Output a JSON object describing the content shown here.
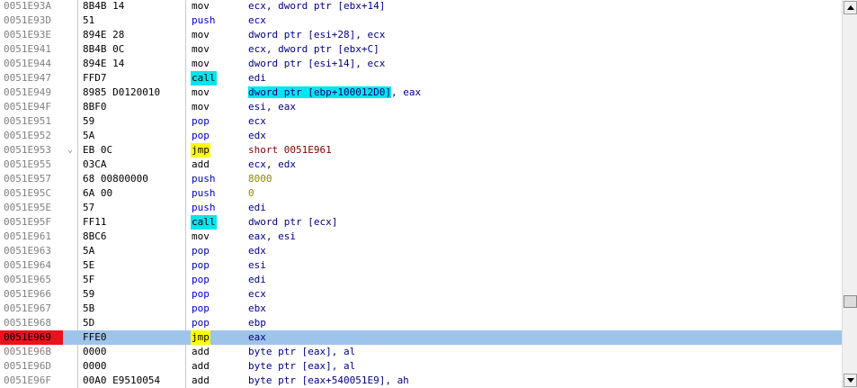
{
  "colors": {
    "selection": "#9fc4ea",
    "current_address": "#e8141b",
    "call_highlight": "#00e5ee",
    "jump_highlight": "#ffff00",
    "address_text": "#808080",
    "operand_text": "#000080",
    "stack_mnemonic": "#0000c8",
    "immediate": "#8a8a00",
    "jump_target": "#800000"
  },
  "icons": {
    "scroll_up": "triangle-up-icon",
    "scroll_down": "triangle-down-icon"
  },
  "scrollbar": {
    "position": 0.81
  },
  "rows": [
    {
      "address": "0051E93A",
      "arrow": "",
      "hex": "8B4B 14",
      "mnemonic": "mov",
      "operands": "ecx, dword ptr [ebx+14]",
      "mnemonic_style": "normal",
      "operand_style": "normal",
      "operand_hl": "",
      "operand_rest": ""
    },
    {
      "address": "0051E93D",
      "arrow": "",
      "hex": "51",
      "mnemonic": "push",
      "operands": "ecx",
      "mnemonic_style": "stack",
      "operand_style": "normal",
      "operand_hl": "",
      "operand_rest": ""
    },
    {
      "address": "0051E93E",
      "arrow": "",
      "hex": "894E 28",
      "mnemonic": "mov",
      "operands": "dword ptr [esi+28], ecx",
      "mnemonic_style": "normal",
      "operand_style": "normal",
      "operand_hl": "",
      "operand_rest": ""
    },
    {
      "address": "0051E941",
      "arrow": "",
      "hex": "8B4B 0C",
      "mnemonic": "mov",
      "operands": "ecx, dword ptr [ebx+C]",
      "mnemonic_style": "normal",
      "operand_style": "normal",
      "operand_hl": "",
      "operand_rest": ""
    },
    {
      "address": "0051E944",
      "arrow": "",
      "hex": "894E 14",
      "mnemonic": "mov",
      "operands": "dword ptr [esi+14], ecx",
      "mnemonic_style": "normal",
      "operand_style": "normal",
      "operand_hl": "",
      "operand_rest": ""
    },
    {
      "address": "0051E947",
      "arrow": "",
      "hex": "FFD7",
      "mnemonic": "call",
      "operands": "edi",
      "mnemonic_style": "call",
      "operand_style": "normal",
      "operand_hl": "",
      "operand_rest": ""
    },
    {
      "address": "0051E949",
      "arrow": "",
      "hex": "8985 D0120010",
      "mnemonic": "mov",
      "operands": "",
      "mnemonic_style": "normal",
      "operand_style": "normal",
      "operand_hl": "dword ptr [ebp+100012D0]",
      "operand_rest": ", eax"
    },
    {
      "address": "0051E94F",
      "arrow": "",
      "hex": "8BF0",
      "mnemonic": "mov",
      "operands": "esi, eax",
      "mnemonic_style": "normal",
      "operand_style": "normal",
      "operand_hl": "",
      "operand_rest": ""
    },
    {
      "address": "0051E951",
      "arrow": "",
      "hex": "59",
      "mnemonic": "pop",
      "operands": "ecx",
      "mnemonic_style": "stack",
      "operand_style": "normal",
      "operand_hl": "",
      "operand_rest": ""
    },
    {
      "address": "0051E952",
      "arrow": "",
      "hex": "5A",
      "mnemonic": "pop",
      "operands": "edx",
      "mnemonic_style": "stack",
      "operand_style": "normal",
      "operand_hl": "",
      "operand_rest": ""
    },
    {
      "address": "0051E953",
      "arrow": "⌄",
      "hex": "EB 0C",
      "mnemonic": "jmp",
      "operands": "short 0051E961",
      "mnemonic_style": "jmp",
      "operand_style": "jump",
      "operand_hl": "",
      "operand_rest": ""
    },
    {
      "address": "0051E955",
      "arrow": "",
      "hex": "03CA",
      "mnemonic": "add",
      "operands": "ecx, edx",
      "mnemonic_style": "normal",
      "operand_style": "normal",
      "operand_hl": "",
      "operand_rest": ""
    },
    {
      "address": "0051E957",
      "arrow": "",
      "hex": "68 00800000",
      "mnemonic": "push",
      "operands": "8000",
      "mnemonic_style": "stack",
      "operand_style": "imm",
      "operand_hl": "",
      "operand_rest": ""
    },
    {
      "address": "0051E95C",
      "arrow": "",
      "hex": "6A 00",
      "mnemonic": "push",
      "operands": "0",
      "mnemonic_style": "stack",
      "operand_style": "imm",
      "operand_hl": "",
      "operand_rest": ""
    },
    {
      "address": "0051E95E",
      "arrow": "",
      "hex": "57",
      "mnemonic": "push",
      "operands": "edi",
      "mnemonic_style": "stack",
      "operand_style": "normal",
      "operand_hl": "",
      "operand_rest": ""
    },
    {
      "address": "0051E95F",
      "arrow": "",
      "hex": "FF11",
      "mnemonic": "call",
      "operands": "dword ptr [ecx]",
      "mnemonic_style": "call",
      "operand_style": "normal",
      "operand_hl": "",
      "operand_rest": ""
    },
    {
      "address": "0051E961",
      "arrow": "",
      "hex": "8BC6",
      "mnemonic": "mov",
      "operands": "eax, esi",
      "mnemonic_style": "normal",
      "operand_style": "normal",
      "operand_hl": "",
      "operand_rest": ""
    },
    {
      "address": "0051E963",
      "arrow": "",
      "hex": "5A",
      "mnemonic": "pop",
      "operands": "edx",
      "mnemonic_style": "stack",
      "operand_style": "normal",
      "operand_hl": "",
      "operand_rest": ""
    },
    {
      "address": "0051E964",
      "arrow": "",
      "hex": "5E",
      "mnemonic": "pop",
      "operands": "esi",
      "mnemonic_style": "stack",
      "operand_style": "normal",
      "operand_hl": "",
      "operand_rest": ""
    },
    {
      "address": "0051E965",
      "arrow": "",
      "hex": "5F",
      "mnemonic": "pop",
      "operands": "edi",
      "mnemonic_style": "stack",
      "operand_style": "normal",
      "operand_hl": "",
      "operand_rest": ""
    },
    {
      "address": "0051E966",
      "arrow": "",
      "hex": "59",
      "mnemonic": "pop",
      "operands": "ecx",
      "mnemonic_style": "stack",
      "operand_style": "normal",
      "operand_hl": "",
      "operand_rest": ""
    },
    {
      "address": "0051E967",
      "arrow": "",
      "hex": "5B",
      "mnemonic": "pop",
      "operands": "ebx",
      "mnemonic_style": "stack",
      "operand_style": "normal",
      "operand_hl": "",
      "operand_rest": ""
    },
    {
      "address": "0051E968",
      "arrow": "",
      "hex": "5D",
      "mnemonic": "pop",
      "operands": "ebp",
      "mnemonic_style": "stack",
      "operand_style": "normal",
      "operand_hl": "",
      "operand_rest": ""
    },
    {
      "address": "0051E969",
      "arrow": "",
      "hex": "FFE0",
      "mnemonic": "jmp",
      "operands": "eax",
      "mnemonic_style": "jmp",
      "operand_style": "normal",
      "operand_hl": "",
      "operand_rest": "",
      "selected": true,
      "current": true
    },
    {
      "address": "0051E96B",
      "arrow": "",
      "hex": "0000",
      "mnemonic": "add",
      "operands": "byte ptr [eax], al",
      "mnemonic_style": "normal",
      "operand_style": "normal",
      "operand_hl": "",
      "operand_rest": ""
    },
    {
      "address": "0051E96D",
      "arrow": "",
      "hex": "0000",
      "mnemonic": "add",
      "operands": "byte ptr [eax], al",
      "mnemonic_style": "normal",
      "operand_style": "normal",
      "operand_hl": "",
      "operand_rest": ""
    },
    {
      "address": "0051E96F",
      "arrow": "",
      "hex": "00A0 E9510054",
      "mnemonic": "add",
      "operands": "byte ptr [eax+540051E9], ah",
      "mnemonic_style": "normal",
      "operand_style": "normal",
      "operand_hl": "",
      "operand_rest": ""
    }
  ]
}
